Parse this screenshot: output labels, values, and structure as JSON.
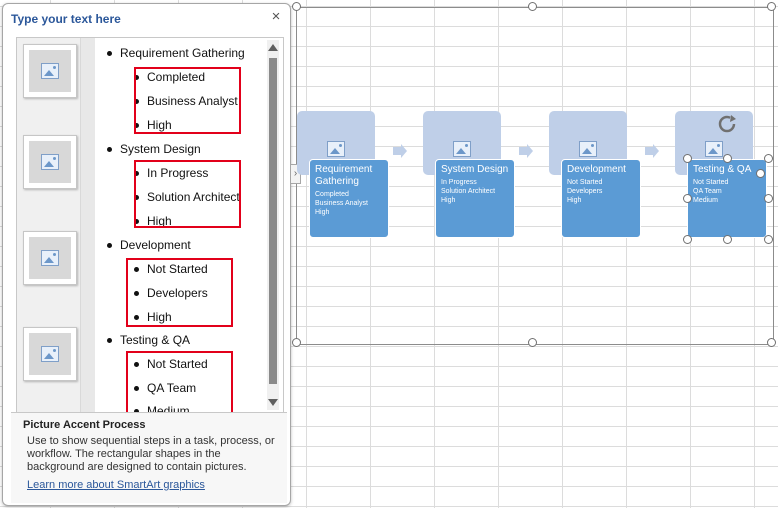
{
  "pane": {
    "title": "Type your text here",
    "close_glyph": "×",
    "items": [
      {
        "text": "Requirement Gathering",
        "children": [
          "Completed",
          "Business Analyst",
          "High"
        ]
      },
      {
        "text": "System Design",
        "children": [
          "In Progress",
          "Solution Architect",
          "High"
        ]
      },
      {
        "text": "Development",
        "children": [
          "Not Started",
          "Developers",
          "High"
        ]
      },
      {
        "text": "Testing & QA",
        "children": [
          "Not Started",
          "QA Team",
          "Medium"
        ]
      }
    ],
    "description_title": "Picture Accent Process",
    "description_text": "Use to show sequential steps in a task, process, or workflow. The rectangular shapes in the background are designed to contain pictures.",
    "learn_more_link": "Learn more about SmartArt graphics"
  },
  "smartart": {
    "boxes": [
      {
        "title": "Requirement Gathering",
        "lines": [
          "Completed",
          "Business Analyst",
          "High"
        ]
      },
      {
        "title": "System Design",
        "lines": [
          "In Progress",
          "Solution Architect",
          "High"
        ]
      },
      {
        "title": "Development",
        "lines": [
          "Not Started",
          "Developers",
          "High"
        ]
      },
      {
        "title": "Testing & QA",
        "lines": [
          "Not Started",
          "QA Team",
          "Medium"
        ]
      }
    ]
  },
  "colors": {
    "accent": "#5b9bd5",
    "picture_box": "#bfcfe8",
    "highlight_box": "#e2001a",
    "pane_title": "#2b579a"
  },
  "icons": [
    "close-icon",
    "picture-placeholder-icon",
    "chevron-arrow-icon",
    "rotate-icon",
    "scroll-up-icon",
    "scroll-down-icon",
    "expander-arrow-icon"
  ]
}
